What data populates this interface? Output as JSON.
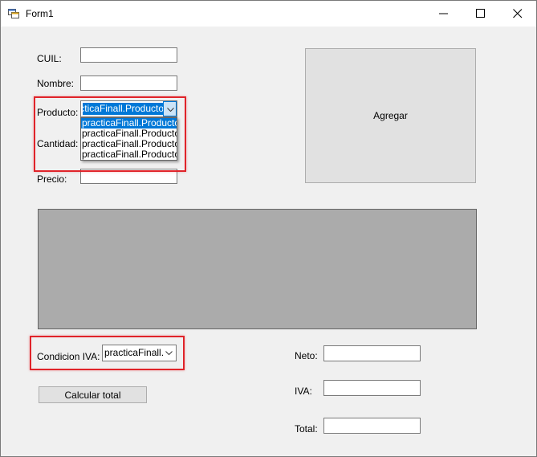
{
  "window": {
    "title": "Form1",
    "icon": "winforms-app-icon",
    "controls": [
      "minimize-icon",
      "maximize-icon",
      "close-icon"
    ]
  },
  "form": {
    "cuil_label": "CUIL:",
    "cuil_value": "",
    "nombre_label": "Nombre:",
    "nombre_value": "",
    "producto_label": "Producto:",
    "producto_selected": "practicaFinall.Producto",
    "producto_options": [
      "practicaFinall.Producto",
      "practicaFinall.Producto",
      "practicaFinall.Producto",
      "practicaFinall.Producto"
    ],
    "cantidad_label": "Cantidad:",
    "precio_label": "Precio:",
    "precio_value": "",
    "agregar_label": "Agregar",
    "condicion_label": "Condicion IVA:",
    "condicion_selected": "practicaFinall.Iv",
    "calcular_label": "Calcular total",
    "neto_label": "Neto:",
    "neto_value": "",
    "iva_label": "IVA:",
    "iva_value": "",
    "total_label": "Total:",
    "total_value": ""
  },
  "colors": {
    "highlight": "#e0242a",
    "selection": "#0078d7",
    "grid_background": "#ababab"
  }
}
